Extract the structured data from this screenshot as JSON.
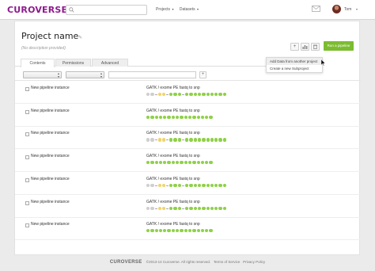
{
  "app": {
    "logo": "CUROVERSE",
    "nav": [
      "Projects",
      "Datasets"
    ],
    "user": "Tom"
  },
  "project": {
    "name": "Project name",
    "description": "(No description provided)"
  },
  "toolbar": {
    "run_label": "Run a pipeline",
    "plus": "+"
  },
  "dropdown_menu": [
    "Add Data from another project",
    "Create a new Subproject"
  ],
  "tabs": [
    "Contents",
    "Permissions",
    "Advanced"
  ],
  "filter_add": "+",
  "rows": [
    {
      "name": "New pipeline instance",
      "workflow": "GATK / exome PE fastq to snp",
      "dots": "grey grey dash yellow yellow dash green green green dash green green green green green green green green green green"
    },
    {
      "name": "New pipeline instance",
      "workflow": "GATK / exome PE fastq to snp",
      "dots": "green green green green green green green green green green green green green green green green"
    },
    {
      "name": "New pipeline instance",
      "workflow": "GATK / exome PE fastq to snp",
      "dots": "grey grey dash yellow yellow dash green green green dash green green green green green green green green green green"
    },
    {
      "name": "New pipeline instance",
      "workflow": "GATK / exome PE fastq to snp",
      "dots": "green green green green green green green green green green green green green green green green"
    },
    {
      "name": "New pipeline instance",
      "workflow": "GATK / exome PE fastq to snp",
      "dots": "grey grey dash yellow yellow dash green green green dash green green green green green green green green green green"
    },
    {
      "name": "New pipeline instance",
      "workflow": "GATK / exome PE fastq to snp",
      "dots": "grey grey dash yellow yellow dash green green green dash green green green green green green green green green green"
    },
    {
      "name": "New pipeline instance",
      "workflow": "GATK / exome PE fastq to snp",
      "dots": "green green green green green green green green green green green green green green green green"
    }
  ],
  "colors": {
    "green": "#8fd147",
    "yellow": "#f2d36b",
    "grey": "#cfcfcf",
    "brand": "#8e1a8e",
    "run_button": "#7cbc30"
  },
  "footer": {
    "logo": "CUROVERSE",
    "copyright": "©2013-14 Curoverse. All rights reserved.",
    "terms": "Terms of Service",
    "privacy": "Privacy Policy"
  }
}
